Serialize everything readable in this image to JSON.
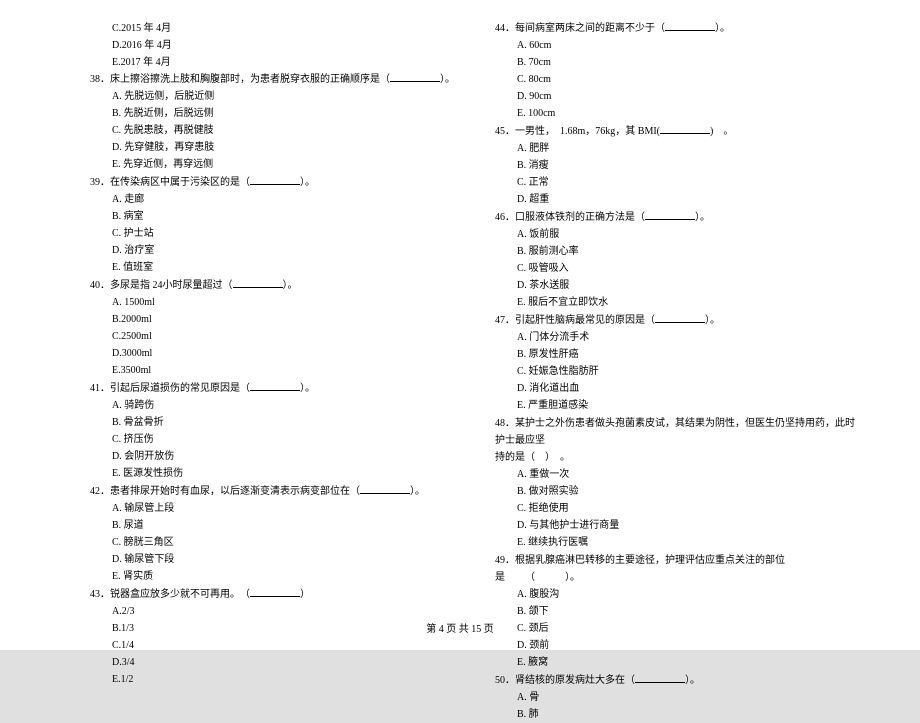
{
  "leftCol": {
    "prevOptions": [
      "C.2015 年 4月",
      "D.2016 年 4月",
      "E.2017 年 4月"
    ],
    "questions": [
      {
        "num": "38．",
        "text": "床上擦浴擦洗上肢和胸腹部时，为患者脱穿衣服的正确顺序是（",
        "blank": true,
        "tail": "）。",
        "options": [
          "A. 先脱远侧，后脱近侧",
          "B. 先脱近侧，后脱远侧",
          "C. 先脱患肢，再脱健肢",
          "D. 先穿健肢，再穿患肢",
          "E. 先穿近侧，再穿远侧"
        ]
      },
      {
        "num": "39．",
        "text": "在传染病区中属于污染区的是（",
        "blank": true,
        "tail": "）。",
        "options": [
          "A. 走廊",
          "B. 病室",
          "C. 护士站",
          "D. 治疗室",
          "E. 值班室"
        ]
      },
      {
        "num": "40．",
        "text": "多尿是指 24小时尿量超过（",
        "blank": true,
        "tail": "）。",
        "options": [
          "A. 1500ml",
          "B.2000ml",
          "C.2500ml",
          "D.3000ml",
          "E.3500ml"
        ]
      },
      {
        "num": "41．",
        "text": "引起后尿道损伤的常见原因是（",
        "blank": true,
        "tail": "）。",
        "options": [
          "A. 骑跨伤",
          "B. 骨盆骨折",
          "C. 挤压伤",
          "D. 会阴开放伤",
          "E. 医源发性损伤"
        ]
      },
      {
        "num": "42．",
        "text": "患者排尿开始时有血尿，以后逐渐变清表示病变部位在（",
        "blank": true,
        "tail": "）。",
        "options": [
          "A. 输尿管上段",
          "B. 尿道",
          "C. 膀胱三角区",
          "D. 输尿管下段",
          "E. 肾实质"
        ]
      },
      {
        "num": "43．",
        "text": "锐器盒应放多少就不可再用。　（",
        "blank": true,
        "tail": "）",
        "options": [
          "A.2/3",
          "B.1/3",
          "C.1/4",
          "D.3/4",
          "E.1/2"
        ]
      }
    ]
  },
  "rightCol": {
    "questions": [
      {
        "num": "44．",
        "text": "每间病室两床之间的距离不少于（",
        "blank": true,
        "tail": "）。",
        "options": [
          "A.  60cm",
          "B.  70cm",
          "C.  80cm",
          "D.  90cm",
          "E.  100cm"
        ]
      },
      {
        "num": "45．",
        "text": "一男性，　1.68m，76kg，其 BMI(",
        "blank": true,
        "tail": ")　。",
        "options": [
          "A. 肥胖",
          "B. 消瘦",
          "C. 正常",
          "D. 超重"
        ]
      },
      {
        "num": "46．",
        "text": "口服液体铁剂的正确方法是（",
        "blank": true,
        "tail": "）。",
        "options": [
          "A. 饭前服",
          "B. 服前测心率",
          "C. 吸管吸入",
          "D. 茶水送服",
          "E. 服后不宜立即饮水"
        ]
      },
      {
        "num": "47．",
        "text": "引起肝性脑病最常见的原因是（",
        "blank": true,
        "tail": "）。",
        "options": [
          "A. 门体分流手术",
          "B. 原发性肝癌",
          "C. 妊娠急性脂肪肝",
          "D. 消化道出血",
          "E. 严重胆道感染"
        ]
      },
      {
        "num": "48．",
        "text": "某护士之外伤患者做头孢菌素皮试，其结果为阴性，但医生仍坚持用药，此时护士最应坚",
        "blank": false,
        "tail": "",
        "trailing": "持的是（　）　。",
        "options": [
          "A.  重做一次",
          "B.  做对照实验",
          "C.  拒绝使用",
          "D.  与其他护士进行商量",
          "E.  继续执行医嘱"
        ]
      },
      {
        "num": "49．",
        "text": "根据乳腺癌淋巴转移的主要途径，护理评估应重点关注的部位是",
        "blank": false,
        "tail": "",
        "tailSpaced": "（　　　）。",
        "options": [
          "A. 腹股沟",
          "B. 颌下",
          "C. 颈后",
          "D. 颈前",
          "E. 腋窝"
        ]
      },
      {
        "num": "50．",
        "text": "肾结核的原发病灶大多在（",
        "blank": true,
        "tail": "）。",
        "options": [
          "A. 骨",
          "B. 肺"
        ]
      }
    ]
  },
  "footer": {
    "prefix": "第  ",
    "page": "4",
    "mid": " 页 共  ",
    "total": "15",
    "suffix": " 页"
  }
}
